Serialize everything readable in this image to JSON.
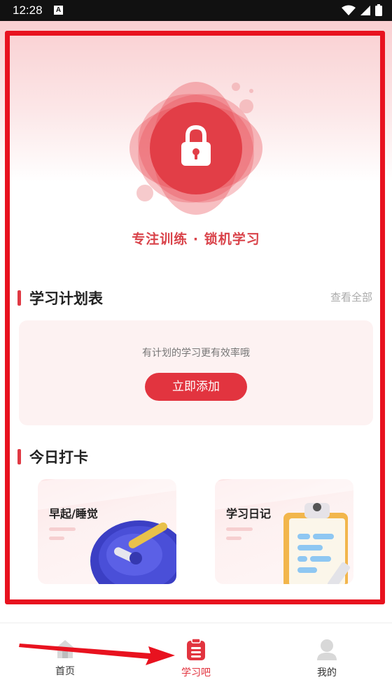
{
  "status_bar": {
    "time": "12:28",
    "notif_icon": "A"
  },
  "hero": {
    "title": "专注训练 · 锁机学习",
    "icon": "lock-icon"
  },
  "plan_section": {
    "title": "学习计划表",
    "view_all": "查看全部",
    "empty_hint": "有计划的学习更有效率哦",
    "add_button": "立即添加"
  },
  "checkin_section": {
    "title": "今日打卡",
    "cards": [
      {
        "title": "早起/睡觉",
        "icon": "clock-icon"
      },
      {
        "title": "学习日记",
        "icon": "clipboard-icon"
      }
    ]
  },
  "bottom_nav": {
    "items": [
      {
        "label": "首页",
        "icon": "home-icon"
      },
      {
        "label": "学习吧",
        "icon": "study-icon",
        "active": true
      },
      {
        "label": "我的",
        "icon": "profile-icon"
      }
    ]
  },
  "colors": {
    "accent": "#e2343f",
    "annotation": "#e8121f"
  }
}
